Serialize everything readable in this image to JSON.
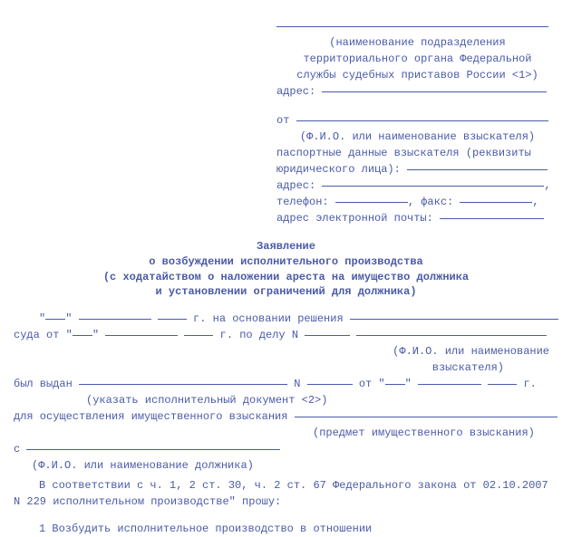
{
  "header": {
    "caption_line1": "(наименование подразделения",
    "caption_line2": "территориального органа Федеральной",
    "caption_line3": "службы судебных приставов России <1>)",
    "address_label": "адрес: ",
    "from_label": "от ",
    "from_caption": "(Ф.И.О. или наименование взыскателя)",
    "passport_line1": "паспортные данные взыскателя (реквизиты",
    "passport_line2": "юридического лица): ",
    "address2_label": "адрес: ",
    "phone_label": "телефон: ",
    "fax_label": ", факс: ",
    "comma": ",",
    "email_label": "адрес электронной почты: "
  },
  "title": {
    "line1": "Заявление",
    "line2": "о возбуждении исполнительного производства",
    "line3": "(с ходатайством о наложении ареста на имущество должника",
    "line4": "и установлении ограничений для должника)"
  },
  "body": {
    "date_prefix": "\"",
    "date_mid": "\" ",
    "year_suffix1": " г. на основании решения ",
    "court_prefix": "суда от \"",
    "court_mid": "\" ",
    "year_suffix2": " г. по делу N ",
    "caption_claimant": "(Ф.И.О. или наименование",
    "caption_claimant2": "взыскателя)",
    "issued_prefix": "был выдан ",
    "n_label": " N ",
    "from_label2": " от \"",
    "year_suffix3": " г.",
    "exec_doc_caption": "(указать исполнительный документ <2>)",
    "recovery_prefix": "для осуществления имущественного взыскания ",
    "recovery_caption": "(предмет имущественного взыскания)",
    "with_prefix": "с ",
    "debtor_caption": "(Ф.И.О. или наименование должника)",
    "law_text": "В соответствии с ч. 1, 2 ст. 30, ч. 2 ст. 67 Федерального закона от 02.10.2007 N 229 исполнительном производстве\" прошу:",
    "item1": "1   Возбудить исполнительное производство в отношении"
  }
}
